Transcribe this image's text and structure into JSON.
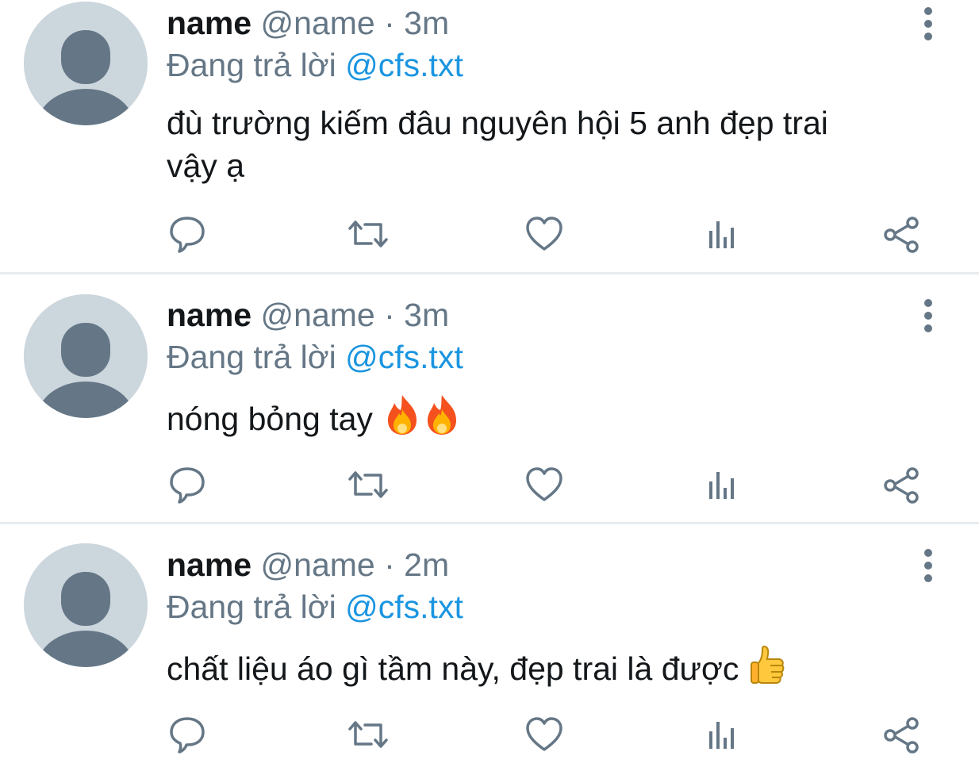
{
  "tweets": [
    {
      "name": "name",
      "handle": "@name",
      "dot": "·",
      "time": "3m",
      "replying_prefix": "Đang trả lời",
      "replying_to": "@cfs.txt",
      "text_line1": "đù trường kiếm đâu nguyên hội 5 anh đẹp trai",
      "text_line2": "vậy ạ",
      "emojis": []
    },
    {
      "name": "name",
      "handle": "@name",
      "dot": "·",
      "time": "3m",
      "replying_prefix": "Đang trả lời",
      "replying_to": "@cfs.txt",
      "text_line1": "nóng bỏng tay",
      "emojis": [
        "fire-emoji",
        "fire-emoji"
      ]
    },
    {
      "name": "name",
      "handle": "@name",
      "dot": "·",
      "time": "2m",
      "replying_prefix": "Đang trả lời",
      "replying_to": "@cfs.txt",
      "text_line1": "chất liệu áo gì tầm này, đẹp trai là được",
      "emojis": [
        "thumbs-up-emoji"
      ]
    }
  ],
  "action_icons": [
    "reply-icon",
    "retweet-icon",
    "like-icon",
    "analytics-icon",
    "share-icon"
  ],
  "colors": {
    "text_primary": "#14171a",
    "text_secondary": "#657786",
    "link": "#1b95e0",
    "avatar_bg": "#ccd6dd",
    "avatar_fg": "#657786",
    "divider": "#e6ecf0"
  }
}
